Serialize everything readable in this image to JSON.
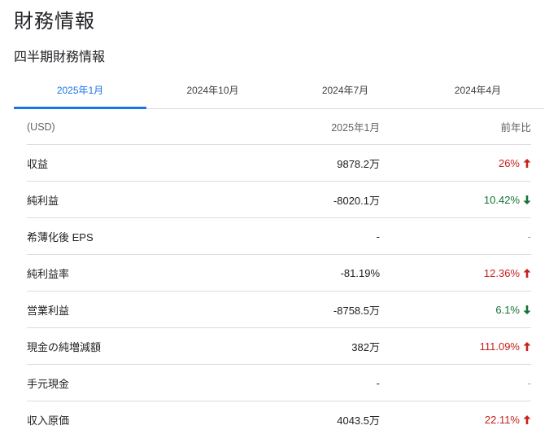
{
  "page_title": "財務情報",
  "section_title": "四半期財務情報",
  "tabs": [
    {
      "label": "2025年1月",
      "active": true
    },
    {
      "label": "2024年10月",
      "active": false
    },
    {
      "label": "2024年7月",
      "active": false
    },
    {
      "label": "2024年4月",
      "active": false
    }
  ],
  "table": {
    "header": {
      "label": "(USD)",
      "value": "2025年1月",
      "yoy": "前年比"
    },
    "rows": [
      {
        "label": "収益",
        "value": "9878.2万",
        "yoy": "26%",
        "trend": "up"
      },
      {
        "label": "純利益",
        "value": "-8020.1万",
        "yoy": "10.42%",
        "trend": "down"
      },
      {
        "label": "希薄化後 EPS",
        "value": "-",
        "yoy": "-",
        "trend": "none"
      },
      {
        "label": "純利益率",
        "value": "-81.19%",
        "yoy": "12.36%",
        "trend": "up"
      },
      {
        "label": "営業利益",
        "value": "-8758.5万",
        "yoy": "6.1%",
        "trend": "down"
      },
      {
        "label": "現金の純増減額",
        "value": "382万",
        "yoy": "111.09%",
        "trend": "up"
      },
      {
        "label": "手元現金",
        "value": "-",
        "yoy": "-",
        "trend": "none"
      },
      {
        "label": "収入原価",
        "value": "4043.5万",
        "yoy": "22.11%",
        "trend": "up"
      }
    ]
  },
  "colors": {
    "accent": "#1a73e8",
    "up": "#c5221f",
    "down": "#137333",
    "divider": "#dadce0"
  },
  "icons": {
    "up": "arrow-up-icon",
    "down": "arrow-down-icon"
  }
}
